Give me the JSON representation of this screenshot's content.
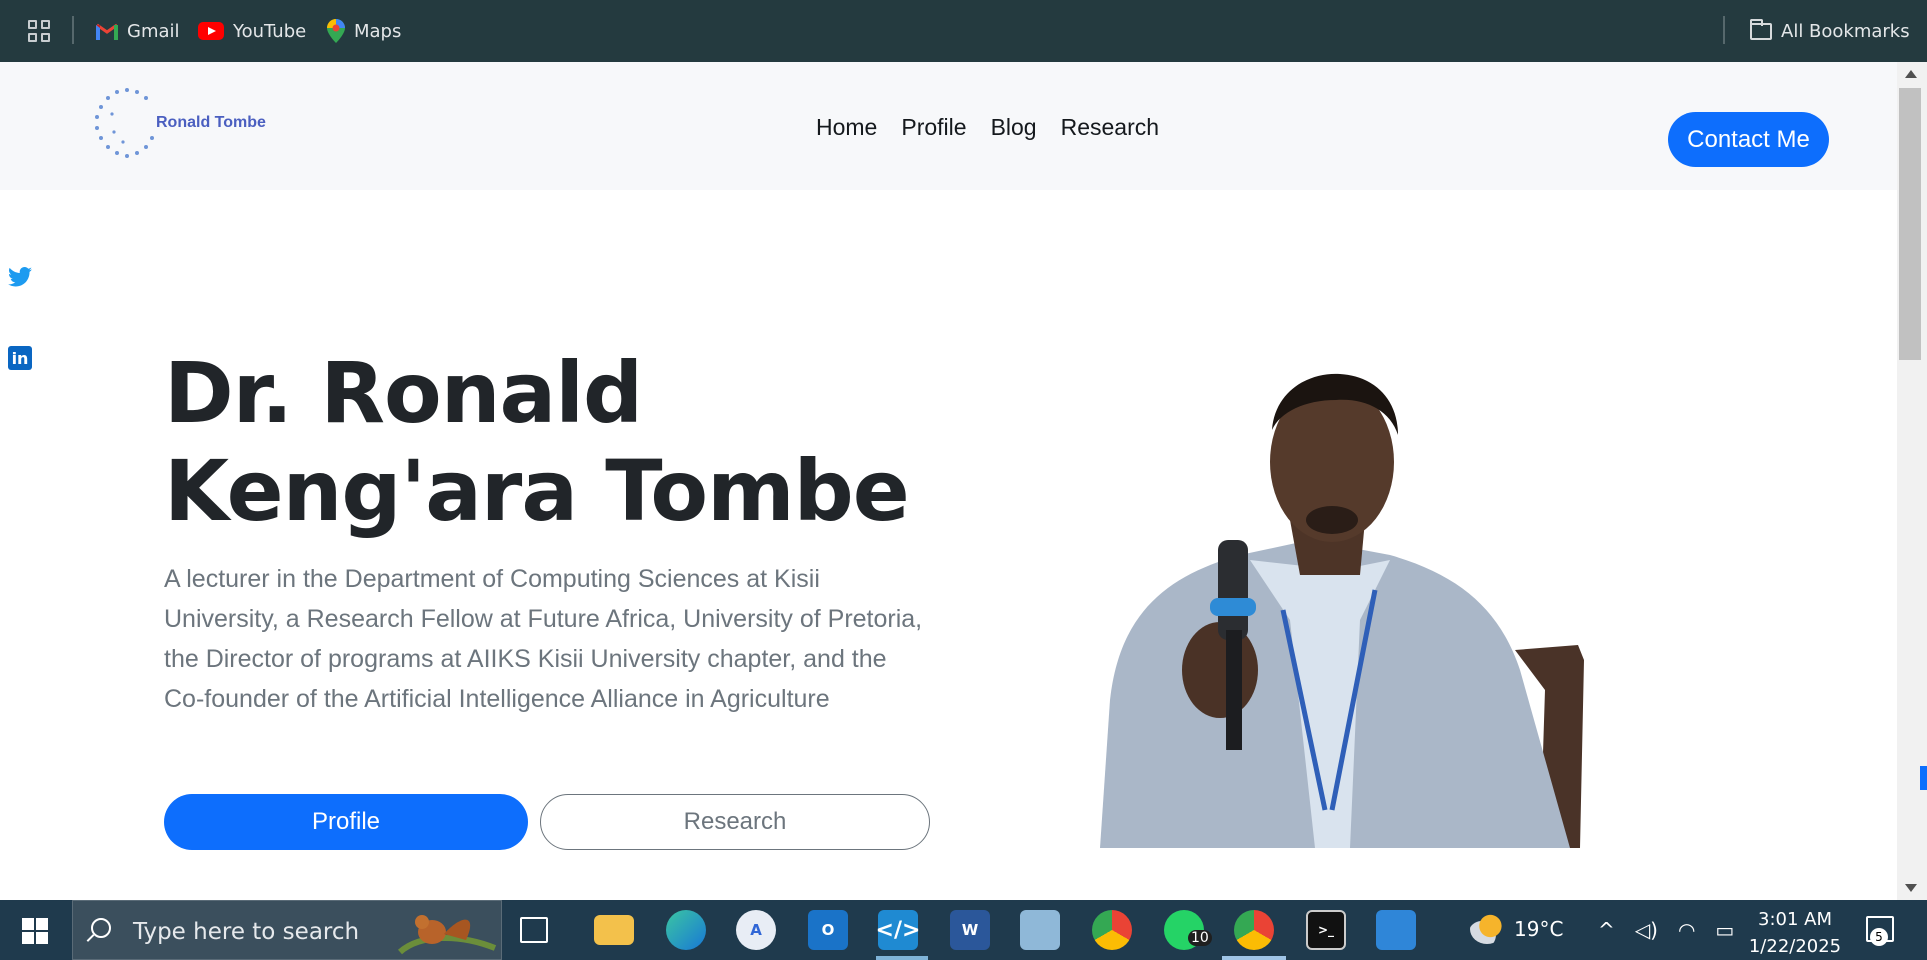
{
  "bookmarks": {
    "items": [
      {
        "label": "Gmail",
        "icon": "gmail-icon"
      },
      {
        "label": "YouTube",
        "icon": "youtube-icon"
      },
      {
        "label": "Maps",
        "icon": "maps-icon"
      }
    ],
    "all_bookmarks": "All Bookmarks"
  },
  "site": {
    "logo_text": "Ronald Tombe",
    "nav": [
      "Home",
      "Profile",
      "Blog",
      "Research"
    ],
    "contact_label": "Contact Me",
    "accent": "#0d6efd"
  },
  "hero": {
    "title_line1": "Dr. Ronald",
    "title_line2": "Keng'ara Tombe",
    "description": "A lecturer in the Department of Computing Sciences at Kisii University, a Research Fellow at Future Africa, University of Pretoria, the Director of programs at AIIKS Kisii University chapter, and the Co-founder of the Artificial Intelligence Alliance in Agriculture",
    "profile_button": "Profile",
    "research_button": "Research"
  },
  "taskbar": {
    "search_placeholder": "Type here to search",
    "whatsapp_badge": "10",
    "weather": "19°C",
    "time": "3:01 AM",
    "date": "1/22/2025",
    "notifications": "5"
  }
}
